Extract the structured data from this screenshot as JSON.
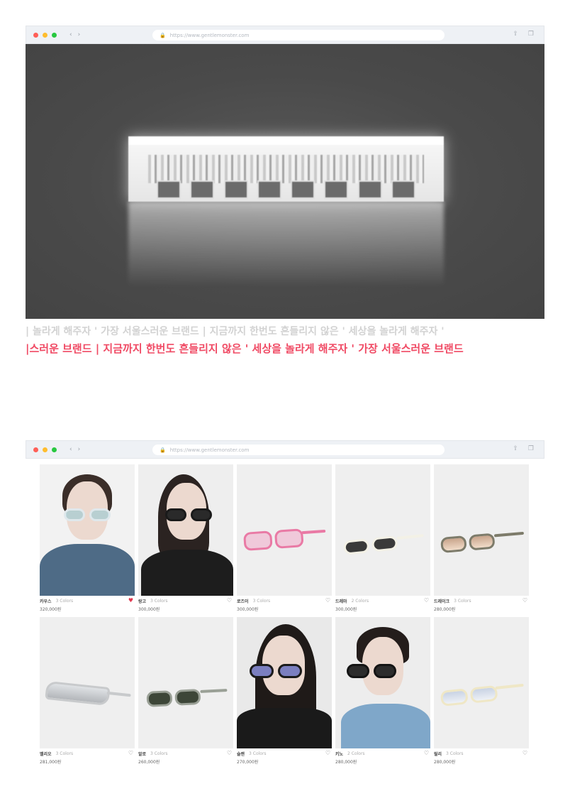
{
  "browser_top": {
    "dots": [
      "#ff5f57",
      "#ffbd2e",
      "#28c840"
    ],
    "address_url": "https://www.gentlemonster.com",
    "hero": {
      "description_icon": "building-icon"
    }
  },
  "marquee": {
    "gray_text": "| 놀라게 해주자 ' 가장 서울스러운 브랜드 | 지금까지 한번도 흔들리지 않은 ' 세상을 놀라게 해주자 '",
    "red_text": "|스러운 브랜드 | 지금까지 한번도 흔들리지 않은 ' 세상을 놀라게 해주자 ' 가장 서울스러운 브랜드"
  },
  "browser_bottom": {
    "address_url": "https://www.gentlemonster.com",
    "products": [
      {
        "name": "카우스",
        "sub": "3 Colors",
        "price": "320,000원",
        "image": "model-1"
      },
      {
        "name": "랑고",
        "sub": "3 Colors",
        "price": "300,000원",
        "image": "model-2"
      },
      {
        "name": "로즈이",
        "sub": "3 Colors",
        "price": "300,000원",
        "image": "pink-glasses"
      },
      {
        "name": "드레마",
        "sub": "2 Colors",
        "price": "300,000원",
        "image": "white-glasses"
      },
      {
        "name": "드레이크",
        "sub": "3 Colors",
        "price": "280,000원",
        "image": "brown-glasses"
      },
      {
        "name": "벨리오",
        "sub": "3 Colors",
        "price": "281,000원",
        "image": "silver-shield"
      },
      {
        "name": "알로",
        "sub": "3 Colors",
        "price": "260,000원",
        "image": "green-glasses"
      },
      {
        "name": "슬랜",
        "sub": "3 Colors",
        "price": "270,000원",
        "image": "model-3"
      },
      {
        "name": "키노",
        "sub": "2 Colors",
        "price": "280,000원",
        "image": "model-4"
      },
      {
        "name": "릴리",
        "sub": "3 Colors",
        "price": "280,000원",
        "image": "cream-glasses"
      }
    ]
  }
}
